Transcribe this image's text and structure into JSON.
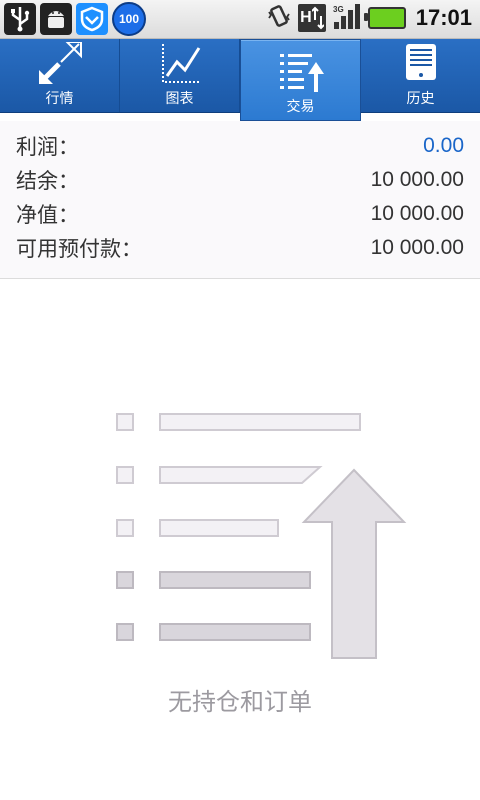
{
  "status_bar": {
    "time": "17:01",
    "badge": "100",
    "network": "H",
    "icons": [
      "usb-icon",
      "android-debug-icon",
      "shield-icon",
      "badge-100-icon",
      "vibrate-icon",
      "data-transfer-icon",
      "signal-3g-icon",
      "battery-icon"
    ]
  },
  "tabs": [
    {
      "label": "行情",
      "icon": "quotes-arrows-icon",
      "active": false
    },
    {
      "label": "图表",
      "icon": "chart-icon",
      "active": false
    },
    {
      "label": "交易",
      "icon": "trade-list-icon",
      "active": true
    },
    {
      "label": "历史",
      "icon": "history-icon",
      "active": false
    }
  ],
  "account": {
    "profit_label": "利润：",
    "profit_value": "0.00",
    "balance_label": "结余：",
    "balance_value": "10 000.00",
    "equity_label": "净值：",
    "equity_value": "10 000.00",
    "free_margin_label": "可用预付款：",
    "free_margin_value": "10 000.00"
  },
  "empty_state": {
    "icon": "empty-orders-icon",
    "message": "无持仓和订单"
  },
  "colors": {
    "tab_bar": "#1b58a6",
    "tab_active": "#3b86d9",
    "profit_value": "#1a66c9",
    "empty_text": "#9c9aa0"
  }
}
